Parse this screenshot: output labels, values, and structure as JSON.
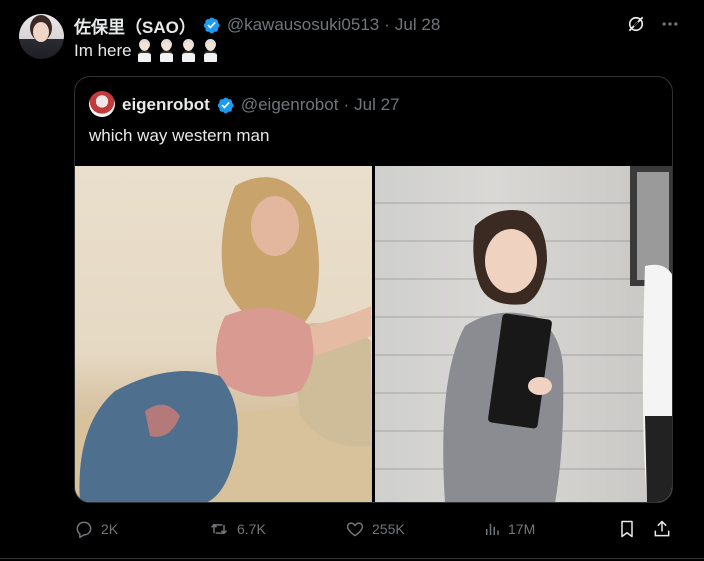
{
  "tweet": {
    "author": {
      "display_name": "佐保里（SAO）",
      "handle": "@kawausosuki0513",
      "verified": true
    },
    "separator": "·",
    "date": "Jul 28",
    "text": "Im here",
    "emoji_count": 4,
    "emoji_icon": "person-in-suit-emoji"
  },
  "quoted_tweet": {
    "author": {
      "display_name": "eigenrobot",
      "handle": "@eigenrobot",
      "verified": true
    },
    "separator": "·",
    "date": "Jul 27",
    "text": "which way western man",
    "media": [
      {
        "icon": "photo-woman-on-couch"
      },
      {
        "icon": "photo-woman-in-suit"
      }
    ]
  },
  "actions": {
    "replies": "2K",
    "reposts": "6.7K",
    "likes": "255K",
    "views": "17M"
  },
  "colors": {
    "background": "#000000",
    "text": "#e7e9ea",
    "muted": "#71767b",
    "border": "#2f3336",
    "verified": "#1d9bf0"
  }
}
